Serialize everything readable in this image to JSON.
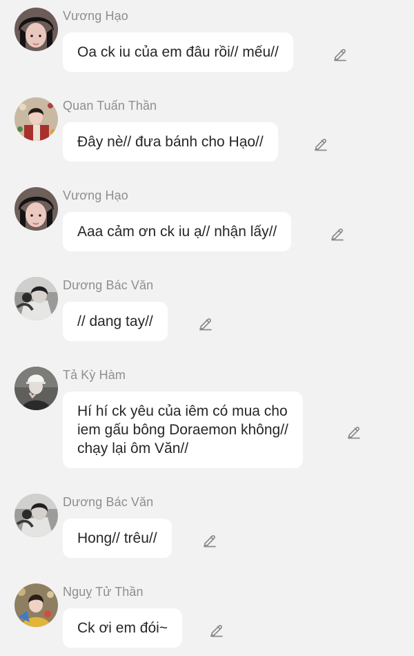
{
  "colors": {
    "background": "#f2f2f2",
    "bubble": "#ffffff",
    "name_text": "#8e8e8e",
    "message_text": "#262626",
    "edit_icon": "#8a8a8a"
  },
  "messages": [
    {
      "sender": "Vương Hạo",
      "text": "Oa ck iu của em đâu rồi// mếu//",
      "avatar_icon": "avatar-icon",
      "action_icon": "pencil-icon"
    },
    {
      "sender": "Quan Tuấn Thần",
      "text": "Đây nè// đưa bánh cho Hạo//",
      "avatar_icon": "avatar-icon",
      "action_icon": "pencil-icon"
    },
    {
      "sender": "Vương Hạo",
      "text": "Aaa cảm ơn ck iu ạ// nhận lấy//",
      "avatar_icon": "avatar-icon",
      "action_icon": "pencil-icon"
    },
    {
      "sender": "Dương Bác Văn",
      "text": "// dang tay//",
      "avatar_icon": "avatar-icon",
      "action_icon": "pencil-icon"
    },
    {
      "sender": "Tả Kỳ Hàm",
      "text": "Hí hí ck yêu của iêm có mua cho\niem gấu bông Doraemon không//\nchạy lại ôm Văn//",
      "avatar_icon": "avatar-icon",
      "action_icon": "pencil-icon"
    },
    {
      "sender": "Dương Bác Văn",
      "text": "Hong// trêu//",
      "avatar_icon": "avatar-icon",
      "action_icon": "pencil-icon"
    },
    {
      "sender": "Nguỵ Tử Thần",
      "text": "Ck ơi em đói~",
      "avatar_icon": "avatar-icon",
      "action_icon": "pencil-icon"
    }
  ]
}
